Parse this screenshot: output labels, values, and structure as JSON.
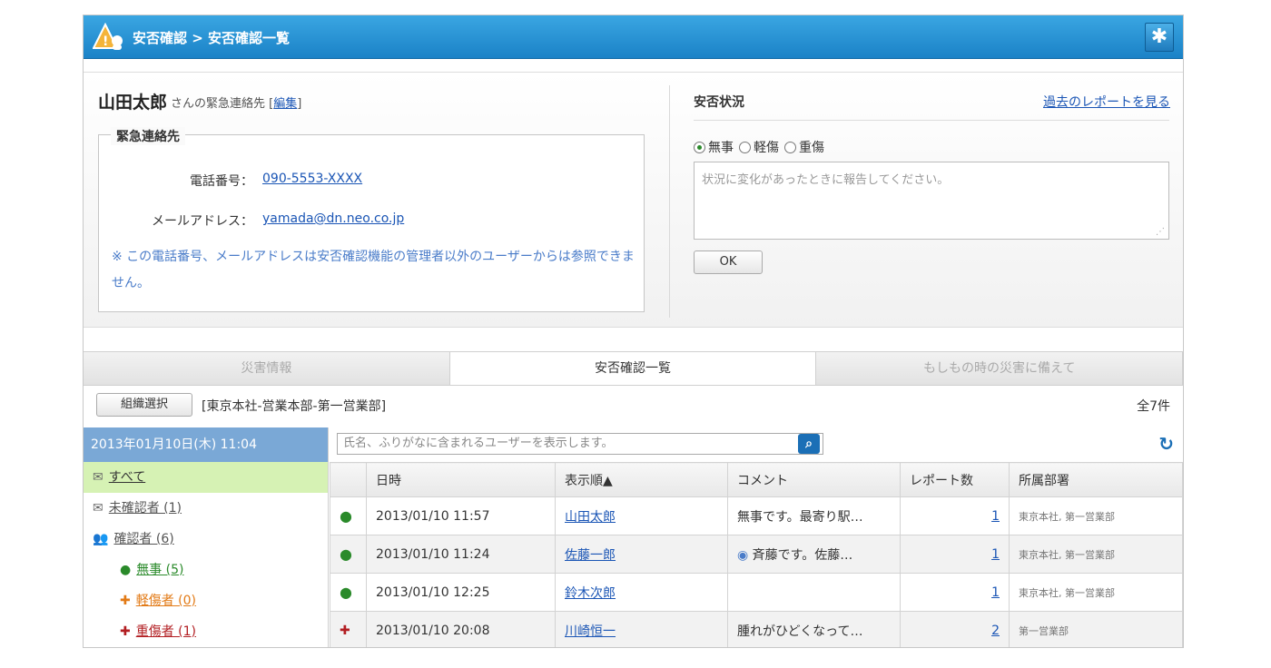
{
  "header": {
    "breadcrumb": "安否確認 > 安否確認一覧",
    "settings_icon": "gear-icon"
  },
  "user": {
    "name": "山田太郎",
    "suffix": "さんの緊急連絡先",
    "edit_prefix": "[",
    "edit_label": "編集",
    "edit_suffix": "]"
  },
  "contact": {
    "legend": "緊急連絡先",
    "phone_label": "電話番号：",
    "phone_value": "090-5553-XXXX",
    "mail_label": "メールアドレス：",
    "mail_value": "yamada@dn.neo.co.jp",
    "note": "※ この電話番号、メールアドレスは安否確認機能の管理者以外のユーザーからは参照できません。"
  },
  "status": {
    "title": "安否状況",
    "past_link": "過去のレポートを見る",
    "options": [
      "無事",
      "軽傷",
      "重傷"
    ],
    "selected": "無事",
    "placeholder": "状況に変化があったときに報告してください。",
    "ok_label": "OK"
  },
  "tabs": [
    "災害情報",
    "安否確認一覧",
    "もしもの時の災害に備えて"
  ],
  "active_tab": "安否確認一覧",
  "org": {
    "button": "組織選択",
    "selected": "[東京本社-営業本部-第一営業部]",
    "total": "全7件"
  },
  "sidebar": {
    "date": "2013年01月10日(木) 11:04",
    "items": [
      {
        "label": "すべて"
      },
      {
        "label": "未確認者 (1)"
      },
      {
        "label": "確認者 (6)"
      },
      {
        "label": "無事 (5)"
      },
      {
        "label": "軽傷者 (0)"
      },
      {
        "label": "重傷者 (1)"
      }
    ]
  },
  "search": {
    "placeholder": "氏名、ふりがなに含まれるユーザーを表示します。"
  },
  "table": {
    "headers": [
      "日時",
      "表示順▲",
      "コメント",
      "レポート数",
      "所属部署"
    ],
    "rows": [
      {
        "datetime": "2013/01/10 11:57",
        "name": "山田太郎",
        "comment": "無事です。最寄り駅…",
        "reports": "1",
        "dept": "東京本社, 第一営業部"
      },
      {
        "datetime": "2013/01/10 11:24",
        "name": "佐藤一郎",
        "comment": "斉藤です。佐藤…",
        "reports": "1",
        "dept": "東京本社, 第一営業部"
      },
      {
        "datetime": "2013/01/10 12:25",
        "name": "鈴木次郎",
        "comment": "",
        "reports": "1",
        "dept": "東京本社, 第一営業部"
      },
      {
        "datetime": "2013/01/10 20:08",
        "name": "川崎恒一",
        "comment": "腫れがひどくなって…",
        "reports": "2",
        "dept": "第一営業部"
      }
    ]
  }
}
